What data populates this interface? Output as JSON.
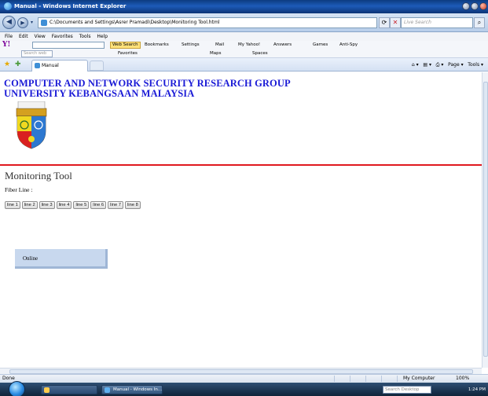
{
  "window": {
    "title": "Manual - Windows Internet Explorer",
    "address": "C:\\Documents and Settings\\Asrer Pramadi\\Desktop\\Monitoring Tool.html",
    "search_placeholder": "Live Search"
  },
  "menu": [
    "File",
    "Edit",
    "View",
    "Favorites",
    "Tools",
    "Help"
  ],
  "yahoo_toolbar": {
    "logo": "Y!",
    "search_button": "Web Search",
    "items": [
      "Bookmarks",
      "Settings",
      "Mail",
      "My Yahoo!",
      "Answers",
      "Games",
      "Anti-Spy"
    ]
  },
  "links_toolbar": {
    "search_placeholder": "Search web",
    "items": [
      "Favorites",
      "Maps",
      "Spaces"
    ]
  },
  "tab": {
    "label": "Manual"
  },
  "command_bar": {
    "page": "Page",
    "tools": "Tools"
  },
  "page": {
    "org_line1": "COMPUTER AND NETWORK SECURITY RESEARCH GROUP",
    "org_line2": "UNIVERSITY KEBANGSAAN MALAYSIA",
    "title": "Monitoring Tool",
    "fiber_label": "Fiber Line :",
    "lines": [
      "line 1",
      "line 2",
      "line 3",
      "line 4",
      "line 5",
      "line 6",
      "line 7",
      "line 8"
    ],
    "status": "Online"
  },
  "statusbar": {
    "left": "Done",
    "zone": "My Computer",
    "zoom": "100%"
  },
  "taskbar": {
    "buttons": [
      "Manual - Windows In..."
    ],
    "search_placeholder": "Search Desktop",
    "clock": "1:24 PM"
  },
  "colors": {
    "org_text": "#1a1ad6",
    "divider": "#e0191f",
    "status_box": "#c8d8ee"
  }
}
